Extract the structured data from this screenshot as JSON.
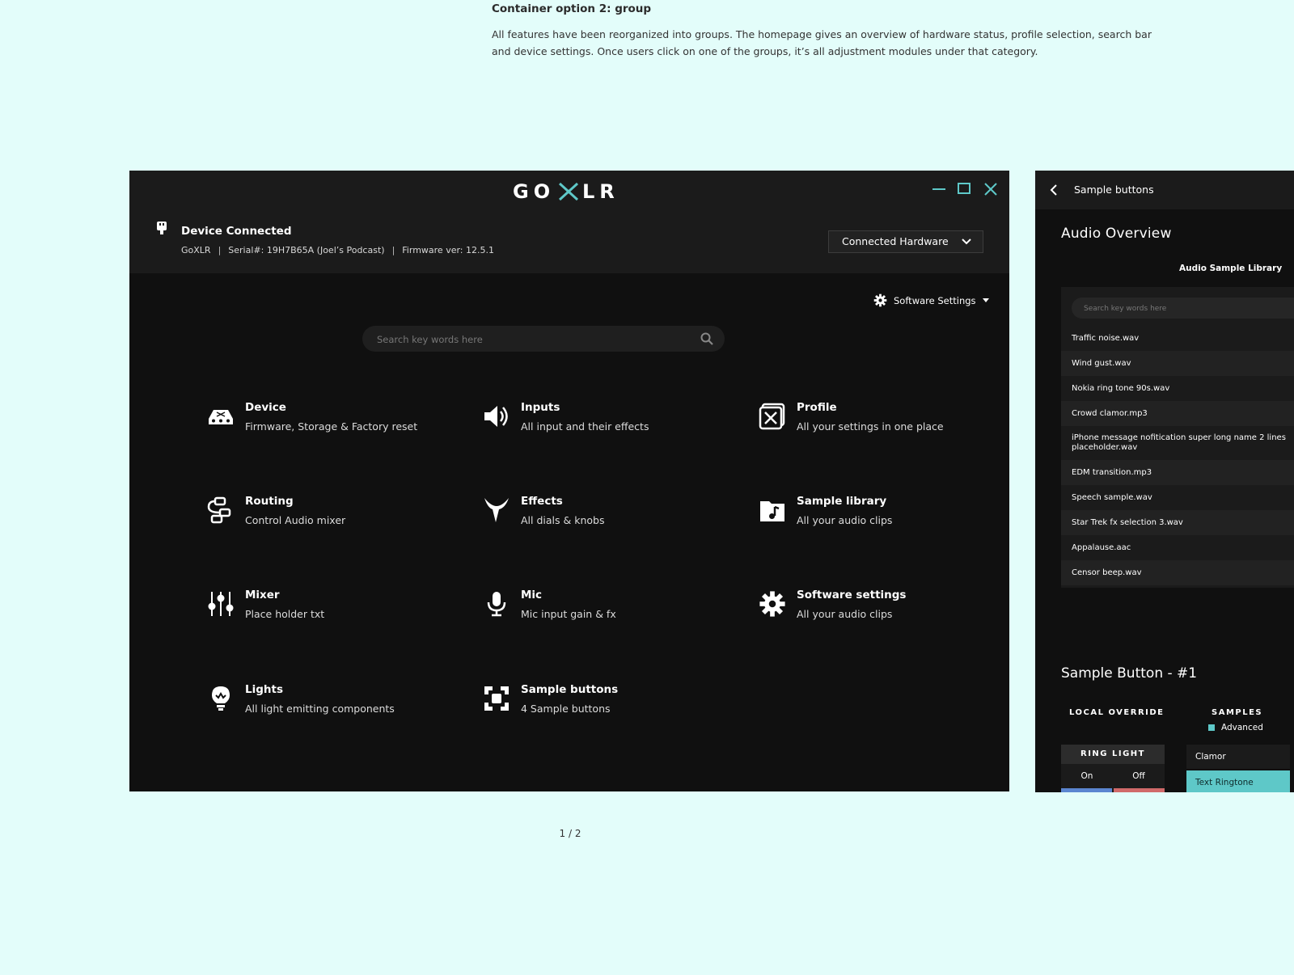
{
  "doc": {
    "title": "Container option 2: group",
    "description": "All features have been reorganized into groups. The homepage gives an overview of hardware status, profile selection, search bar and device settings. Once users click on one of the groups, it’s all adjustment modules under that category.",
    "pager": "1 / 2"
  },
  "app": {
    "logo": "GOXLR",
    "status": {
      "title": "Device Connected",
      "device": "GoXLR",
      "serial": "Serial#: 19H7B65A (Joel’s Podcast)",
      "firmware": "Firmware ver: 12.5.1",
      "separator": "|"
    },
    "hardware_select": "Connected Hardware",
    "software_settings": "Software Settings",
    "search_placeholder": "Search key words here",
    "categories": [
      {
        "title": "Device",
        "subtitle": "Firmware, Storage & Factory reset",
        "icon": "device-icon"
      },
      {
        "title": "Inputs",
        "subtitle": "All input and their effects",
        "icon": "speaker-icon"
      },
      {
        "title": "Profile",
        "subtitle": "All your settings in one place",
        "icon": "profile-icon"
      },
      {
        "title": "Routing",
        "subtitle": "Control Audio mixer",
        "icon": "routing-icon"
      },
      {
        "title": "Effects",
        "subtitle": "All dials & knobs",
        "icon": "effects-icon"
      },
      {
        "title": "Sample library",
        "subtitle": "All your audio clips",
        "icon": "music-folder-icon"
      },
      {
        "title": "Mixer",
        "subtitle": "Place holder txt",
        "icon": "sliders-icon"
      },
      {
        "title": "Mic",
        "subtitle": "Mic input gain & fx",
        "icon": "mic-icon"
      },
      {
        "title": "Software settings",
        "subtitle": "All your audio clips",
        "icon": "gear-icon"
      },
      {
        "title": "Lights",
        "subtitle": "All light emitting components",
        "icon": "bulb-icon"
      },
      {
        "title": "Sample buttons",
        "subtitle": "4 Sample buttons",
        "icon": "sample-buttons-icon"
      }
    ]
  },
  "panel": {
    "header": "Sample buttons",
    "audio_overview": "Audio Overview",
    "library_title": "Audio Sample Library",
    "search_placeholder": "Search key words here",
    "files": [
      "Traffic noise.wav",
      "Wind gust.wav",
      "Nokia ring tone 90s.wav",
      "Crowd clamor.mp3",
      "iPhone message nofitication super long name 2 lines placeholder.wav",
      "EDM transition.mp3",
      "Speech sample.wav",
      "Star Trek fx selection 3.wav",
      "Appalause.aac",
      "Censor beep.wav"
    ],
    "sample_button_title": "Sample Button - #1",
    "local_override": "LOCAL OVERRIDE",
    "samples": "SAMPLES",
    "advanced": "Advanced",
    "ring_light": "RING LIGHT",
    "on": "On",
    "off": "Off",
    "sample_options": [
      "Clamor",
      "Text Ringtone"
    ]
  },
  "colors": {
    "accent": "#5ec8c8",
    "background": "#e3fdfa",
    "window": "#101010",
    "header": "#1b1b1b"
  }
}
